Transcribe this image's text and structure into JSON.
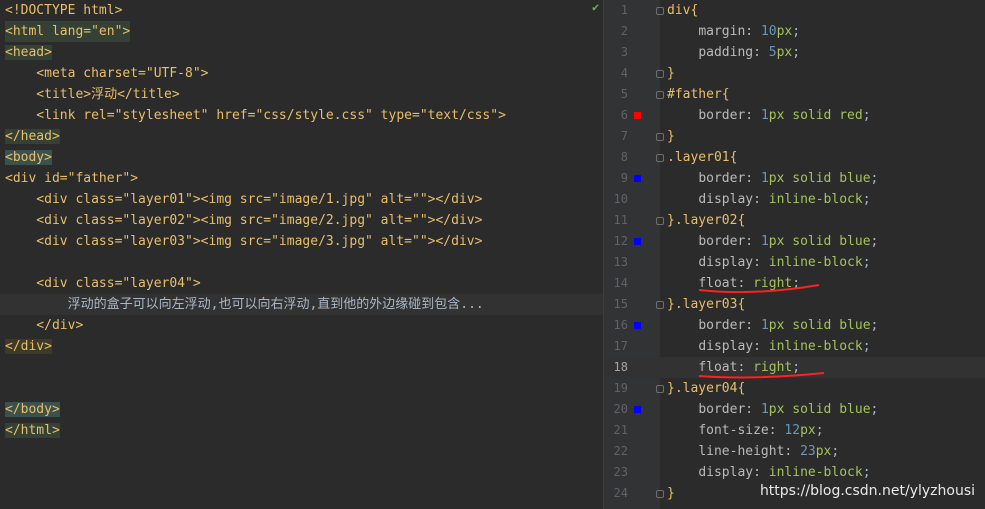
{
  "left_code": {
    "lines": [
      "<!DOCTYPE html>",
      "<html lang=\"en\">",
      "<head>",
      "    <meta charset=\"UTF-8\">",
      "    <title>浮动</title>",
      "    <link rel=\"stylesheet\" href=\"css/style.css\" type=\"text/css\">",
      "</head>",
      "<body>",
      "<div id=\"father\">",
      "    <div class=\"layer01\"><img src=\"image/1.jpg\" alt=\"\"></div>",
      "    <div class=\"layer02\"><img src=\"image/2.jpg\" alt=\"\"></div>",
      "    <div class=\"layer03\"><img src=\"image/3.jpg\" alt=\"\"></div>",
      "",
      "    <div class=\"layer04\">",
      "        浮动的盒子可以向左浮动,也可以向右浮动,直到他的外边缘碰到包含...",
      "    </div>",
      "</div>",
      "",
      "",
      "</body>",
      "</html>"
    ]
  },
  "right_code": {
    "line_numbers": [
      "1",
      "2",
      "3",
      "4",
      "5",
      "6",
      "7",
      "8",
      "9",
      "10",
      "11",
      "12",
      "13",
      "14",
      "15",
      "16",
      "17",
      "18",
      "19",
      "20",
      "21",
      "22",
      "23",
      "24"
    ],
    "current_line": "18",
    "lines": [
      "div{",
      "    margin: 10px;",
      "    padding: 5px;",
      "}",
      "#father{",
      "    border: 1px solid red;",
      "}",
      ".layer01{",
      "    border: 1px solid blue;",
      "    display: inline-block;",
      "}.layer02{",
      "    border: 1px solid blue;",
      "    display: inline-block;",
      "    float: right;",
      "}.layer03{",
      "    border: 1px solid blue;",
      "    display: inline-block;",
      "    float: right;",
      "}.layer04{",
      "    border: 1px solid blue;",
      "    font-size: 12px;",
      "    line-height: 23px;",
      "    display: inline-block;",
      "}"
    ]
  },
  "colors": {
    "red_marker": "#ff0000",
    "blue_marker": "#0000ff",
    "annotation": "#ff2020"
  },
  "watermark": "https://blog.csdn.net/ylyzhousi",
  "icons": {
    "inspection": "checkmark-icon"
  }
}
